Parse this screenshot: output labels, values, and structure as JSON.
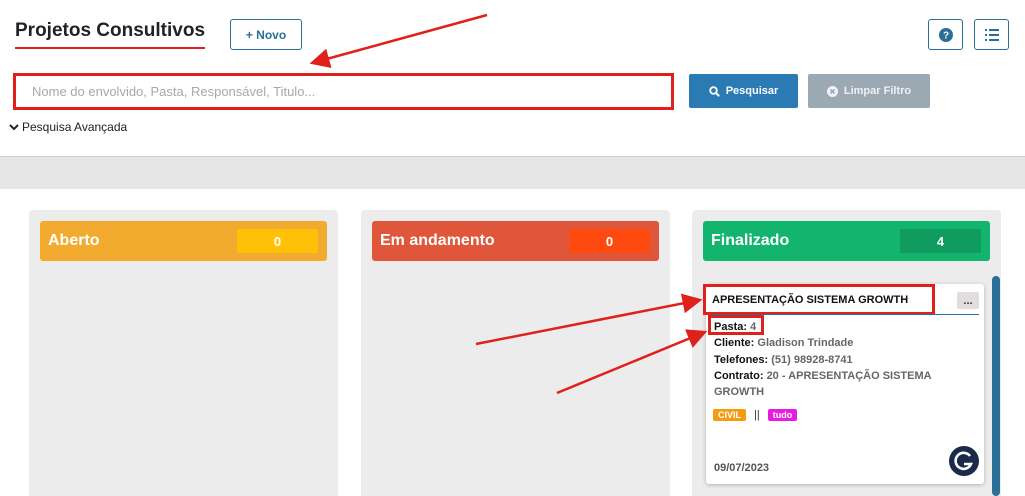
{
  "header": {
    "title": "Projetos Consultivos",
    "new_button": "+ Novo",
    "help_icon": "question-icon",
    "list_icon": "list-icon"
  },
  "search": {
    "placeholder": "Nome do envolvido, Pasta, Responsável, Titulo...",
    "value": "",
    "search_button": "Pesquisar",
    "clear_button": "Limpar Filtro",
    "advanced_label": "Pesquisa Avançada"
  },
  "columns": [
    {
      "title": "Aberto",
      "count": "0",
      "color": "#f2ab2f",
      "count_color": "#ffc107"
    },
    {
      "title": "Em andamento",
      "count": "0",
      "color": "#e0563a",
      "count_color": "#ff4a0f"
    },
    {
      "title": "Finalizado",
      "count": "4",
      "color": "#12b46e",
      "count_color": "#0f9c5e"
    }
  ],
  "card": {
    "title": "APRESENTAÇÃO SISTEMA GROWTH",
    "more_label": "...",
    "pasta_label": "Pasta:",
    "pasta_value": "4",
    "cliente_label": "Cliente:",
    "cliente_value": "Gladison Trindade",
    "telefones_label": "Telefones:",
    "telefones_value": "(51) 98928-8741",
    "contrato_label": "Contrato:",
    "contrato_value": "20 - APRESENTAÇÃO SISTEMA GROWTH",
    "tags": [
      {
        "label": "CIVIL",
        "color": "#f39c12"
      },
      {
        "label": "tudo",
        "color": "#e61ce0"
      }
    ],
    "tag_separator": "||",
    "date": "09/07/2023",
    "avatar_icon": "growth-logo-icon"
  },
  "colors": {
    "accent": "#2a6f97",
    "annotation": "#e0201a"
  }
}
